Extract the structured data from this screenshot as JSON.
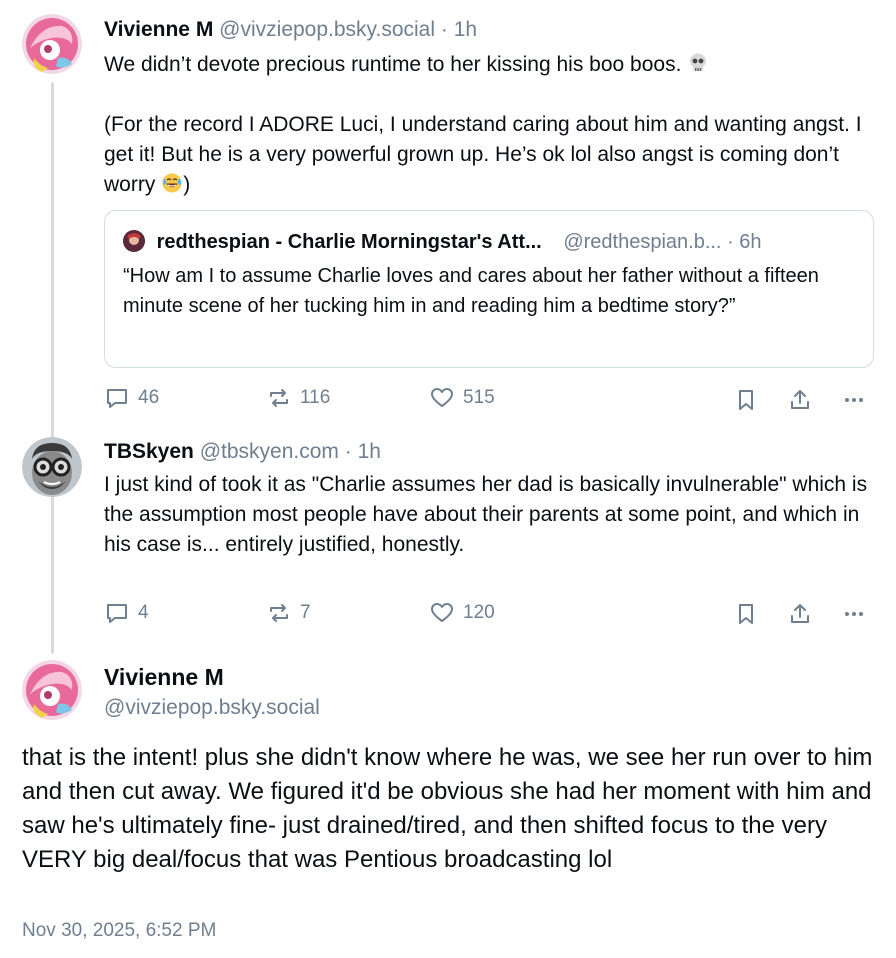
{
  "post1": {
    "display_name": "Vivienne M",
    "handle": "@vivziepop.bsky.social",
    "time": "· 1h",
    "line1": "We didn’t devote precious runtime to her kissing his boo boos.",
    "para2": "(For the record I ADORE Luci, I understand caring about him and wanting angst. I get it! But he is a very powerful grown up. He’s ok lol also angst is coming don’t worry",
    "para2_end": ")",
    "emoji1": "skull-emoji",
    "emoji2": "laughing-tears-emoji",
    "quote": {
      "display_name": "redthespian - Charlie Morningstar's Att...",
      "handle": "@redthespian.b...",
      "time": "· 6h",
      "text": "“How am I to assume Charlie loves and cares about her father without a fifteen minute scene of her tucking him in and reading him a bedtime story?”"
    },
    "replies": "46",
    "reposts": "116",
    "likes": "515"
  },
  "post2": {
    "display_name": "TBSkyen",
    "handle": "@tbskyen.com",
    "time": "· 1h",
    "text": "I just kind of took it as \"Charlie assumes her dad is basically invulnerable\" which is the assumption most people have about their parents at some point, and which in his case is... entirely justified, honestly.",
    "replies": "4",
    "reposts": "7",
    "likes": "120"
  },
  "main_post": {
    "display_name": "Vivienne M",
    "handle": "@vivziepop.bsky.social",
    "text": "that is the intent! plus she didn't know where he was, we see her run over to him and then cut away. We figured it'd be obvious she had her moment with him and saw he's ultimately fine- just drained/tired, and then shifted focus to the very VERY big deal/focus that was Pentious broadcasting lol",
    "timestamp": "Nov 30, 2025, 6:52 PM"
  },
  "colors": {
    "text": "#0b0f14",
    "muted": "#6f7f8f",
    "border": "#d4dbe2"
  }
}
